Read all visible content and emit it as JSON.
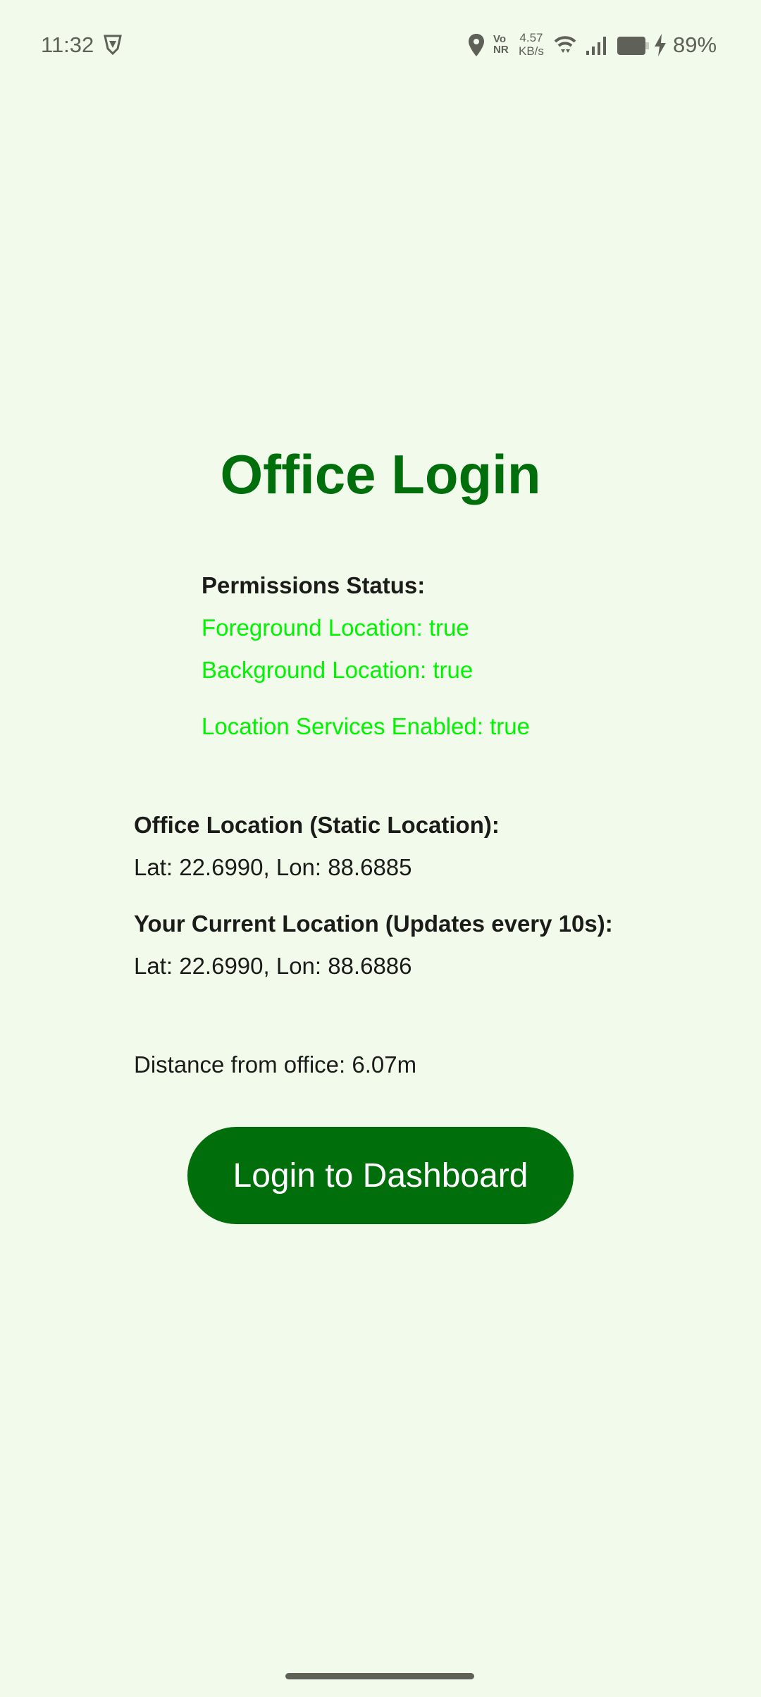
{
  "status_bar": {
    "time": "11:32",
    "net_speed_value": "4.57",
    "net_speed_unit": "KB/s",
    "volte_top": "Vo",
    "volte_bottom": "NR",
    "battery": "89%"
  },
  "title": "Office Login",
  "permissions": {
    "heading": "Permissions Status:",
    "foreground": "Foreground Location: true",
    "background": "Background Location: true",
    "services": "Location Services Enabled: true"
  },
  "office_location": {
    "heading": "Office Location (Static Location):",
    "coords": "Lat: 22.6990, Lon: 88.6885"
  },
  "current_location": {
    "heading": "Your Current Location (Updates every 10s):",
    "coords": "Lat: 22.6990, Lon: 88.6886"
  },
  "distance": "Distance from office: 6.07m",
  "login_button": "Login to Dashboard",
  "colors": {
    "primary": "#006e0a",
    "success": "#00f400",
    "background": "#f2fbeb"
  }
}
